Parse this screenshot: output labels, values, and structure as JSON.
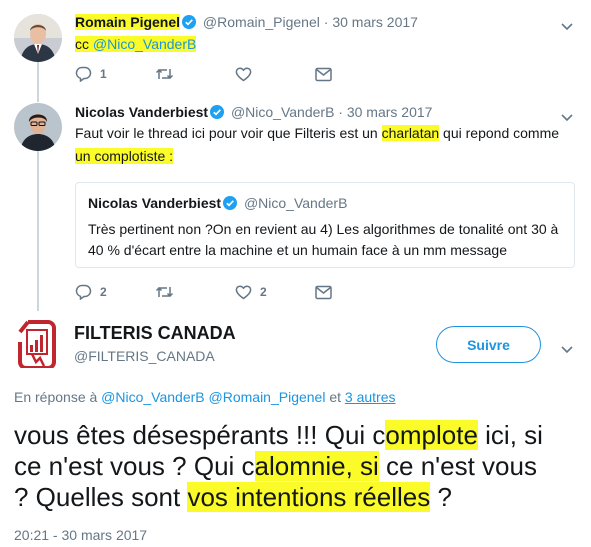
{
  "tweet1": {
    "name": "Romain Pigenel",
    "handle": "@Romain_Pigenel",
    "date": "· 30 mars 2017",
    "text_prefix": "cc ",
    "text_mention": "@Nico_VanderB",
    "reply_count": "1"
  },
  "tweet2": {
    "name": "Nicolas Vanderbiest",
    "handle": "@Nico_VanderB",
    "date": "· 30 mars 2017",
    "text_part1": "Faut voir le thread ici pour voir que Filteris est un ",
    "text_part2": "charlatan",
    "text_part3": " qui repond comme",
    "text_part4": "un complotiste :",
    "reply_count": "2",
    "like_count": "2",
    "quote": {
      "name": "Nicolas Vanderbiest",
      "handle": "@Nico_VanderB",
      "text": "Très pertinent non ?On en revient au 4) Les algorithmes de tonalité ont 30 à 40 % d'écart entre la machine et un humain face à un mm message"
    }
  },
  "main_tweet": {
    "name": "FILTERIS CANADA",
    "handle": "@FILTERIS_CANADA",
    "follow_label": "Suivre",
    "reply_prefix": "En réponse à ",
    "reply_mentions": "@Nico_VanderB @Romain_Pigenel",
    "reply_and": " et ",
    "reply_others": "3 autres",
    "text_l1_a": "vous êtes désespérants !!! Qui c",
    "text_l1_b": "omplote",
    "text_l1_c": " ici, si",
    "text_l2_a": "ce n'est vous ? Qui c",
    "text_l2_b": "alomnie, si",
    "text_l2_c": " ce n'est vous",
    "text_l3_a": "? Quelles sont ",
    "text_l3_b": "vos intentions réelles",
    "text_l3_c": " ?",
    "timestamp": "20:21 - 30 mars 2017"
  },
  "colors": {
    "highlight": "#fbfb2a",
    "link": "#1b95e0",
    "muted": "#657786",
    "verified": "#1da1f2",
    "brand_red": "#c0262d"
  },
  "icons": [
    "reply-icon",
    "retweet-icon",
    "like-icon",
    "message-icon",
    "verified-icon",
    "chevron-down-icon"
  ]
}
